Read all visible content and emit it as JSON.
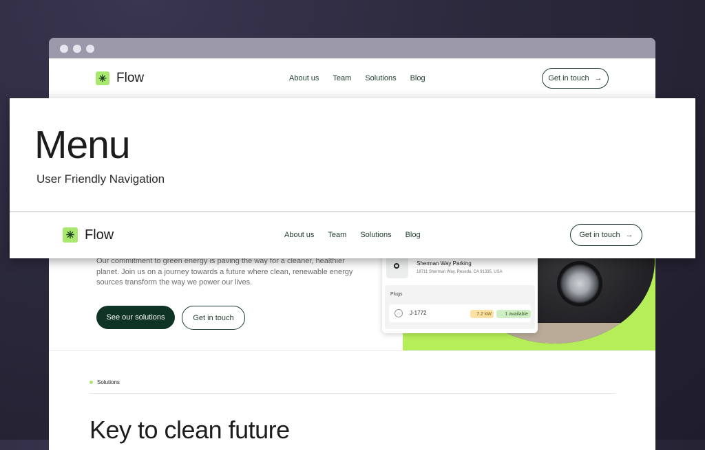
{
  "brand": {
    "name": "Flow",
    "accent": "#a8e86c",
    "dark_green": "#0f3325"
  },
  "nav": {
    "links": [
      "About us",
      "Team",
      "Solutions",
      "Blog"
    ],
    "cta_label": "Get in touch"
  },
  "hero": {
    "text": "Our commitment to green energy is paving the way for a cleaner, healthier planet. Join us on a journey towards a future where clean, renewable energy sources transform the way we power our lives.",
    "primary_button": "See our solutions",
    "secondary_button": "Get in touch"
  },
  "station_card": {
    "title": "Sherman Way Parking",
    "address": "18711 Sherman Way, Reseda, CA 91335, USA",
    "plugs_label": "Plugs",
    "plug": {
      "id": "J-1772",
      "power": "7.2 kW",
      "status": "1 available"
    }
  },
  "section": {
    "tag": "Solutions",
    "heading": "Key to clean future"
  },
  "overlay": {
    "title": "Menu",
    "subtitle": "User Friendly Navigation"
  }
}
